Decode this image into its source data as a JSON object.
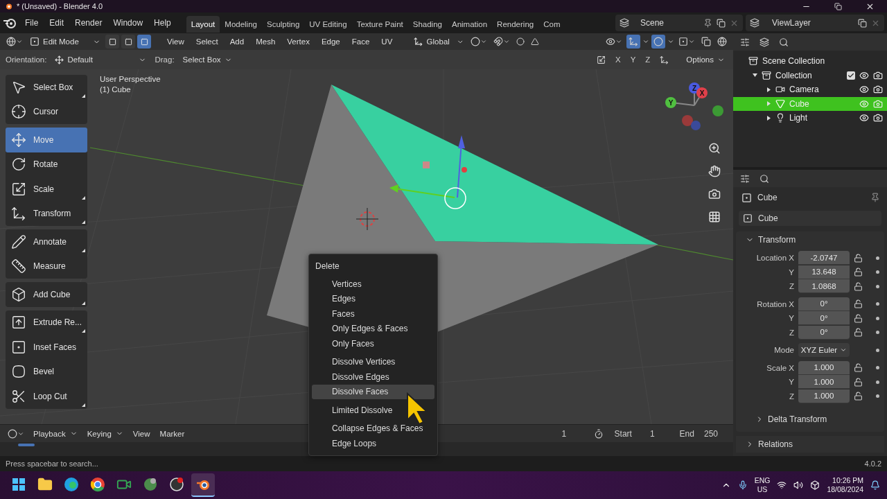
{
  "window": {
    "title": "* (Unsaved) - Blender 4.0"
  },
  "menu": [
    "File",
    "Edit",
    "Render",
    "Window",
    "Help"
  ],
  "workspaces": [
    {
      "label": "Layout",
      "selected": true
    },
    {
      "label": "Modeling",
      "selected": false
    },
    {
      "label": "Sculpting",
      "selected": false
    },
    {
      "label": "UV Editing",
      "selected": false
    },
    {
      "label": "Texture Paint",
      "selected": false
    },
    {
      "label": "Shading",
      "selected": false
    },
    {
      "label": "Animation",
      "selected": false
    },
    {
      "label": "Rendering",
      "selected": false
    },
    {
      "label": "Com",
      "selected": false
    }
  ],
  "scene": {
    "value": "Scene"
  },
  "view_layer": {
    "value": "ViewLayer"
  },
  "viewport_header": {
    "mode": "Edit Mode",
    "select_modes": [
      {
        "selected": false
      },
      {
        "selected": false
      },
      {
        "selected": true
      }
    ],
    "menus": [
      "View",
      "Select",
      "Add",
      "Mesh",
      "Vertex",
      "Edge",
      "Face",
      "UV"
    ],
    "orientation": "Global"
  },
  "tool_settings": {
    "orientation_label": "Orientation:",
    "orientation": "Default",
    "drag_label": "Drag:",
    "drag": "Select Box",
    "axes": [
      "X",
      "Y",
      "Z"
    ],
    "options": "Options"
  },
  "viewport": {
    "view_name": "User Perspective",
    "object_name": "(1) Cube",
    "gizmo_axes": [
      "Z",
      "X",
      "Y"
    ]
  },
  "tools": [
    [
      {
        "label": "Select Box",
        "selected": false,
        "submenu": true
      },
      {
        "label": "Cursor",
        "selected": false,
        "submenu": false
      }
    ],
    [
      {
        "label": "Move",
        "selected": true,
        "submenu": false
      },
      {
        "label": "Rotate",
        "selected": false,
        "submenu": false
      },
      {
        "label": "Scale",
        "selected": false,
        "submenu": true
      },
      {
        "label": "Transform",
        "selected": false,
        "submenu": true
      }
    ],
    [
      {
        "label": "Annotate",
        "selected": false,
        "submenu": true
      },
      {
        "label": "Measure",
        "selected": false,
        "submenu": false
      }
    ],
    [
      {
        "label": "Add Cube",
        "selected": false,
        "submenu": true
      }
    ],
    [
      {
        "label": "Extrude Re...",
        "selected": false,
        "submenu": true
      },
      {
        "label": "Inset Faces",
        "selected": false,
        "submenu": false
      },
      {
        "label": "Bevel",
        "selected": false,
        "submenu": false
      },
      {
        "label": "Loop Cut",
        "selected": false,
        "submenu": true
      }
    ]
  ],
  "delete_menu": {
    "title": "Delete",
    "groups": [
      [
        {
          "label": "Vertices",
          "selected": false
        },
        {
          "label": "Edges",
          "selected": false
        },
        {
          "label": "Faces",
          "selected": false
        },
        {
          "label": "Only Edges & Faces",
          "selected": false
        },
        {
          "label": "Only Faces",
          "selected": false
        }
      ],
      [
        {
          "label": "Dissolve Vertices",
          "selected": false
        },
        {
          "label": "Dissolve Edges",
          "selected": false
        },
        {
          "label": "Dissolve Faces",
          "selected": true
        }
      ],
      [
        {
          "label": "Limited Dissolve",
          "selected": false
        }
      ],
      [
        {
          "label": "Collapse Edges & Faces",
          "selected": false
        },
        {
          "label": "Edge Loops",
          "selected": false
        }
      ]
    ]
  },
  "outliner": {
    "scene_collection": "Scene Collection",
    "collection": {
      "label": "Collection",
      "expanded": true,
      "checked": true,
      "children": [
        {
          "label": "Camera",
          "kind": "camera",
          "selected": false
        },
        {
          "label": "Cube",
          "kind": "mesh",
          "selected": true
        },
        {
          "label": "Light",
          "kind": "light",
          "selected": false
        }
      ]
    }
  },
  "properties": {
    "object": "Cube",
    "data_name": "Cube",
    "transform": {
      "title": "Transform",
      "expanded": true,
      "groups": [
        {
          "kind": "fields",
          "rows": [
            {
              "label": "Location X",
              "value": "-2.0747"
            },
            {
              "label": "Y",
              "value": "13.648"
            },
            {
              "label": "Z",
              "value": "1.0868"
            }
          ]
        },
        {
          "kind": "fields",
          "rows": [
            {
              "label": "Rotation X",
              "value": "0°"
            },
            {
              "label": "Y",
              "value": "0°"
            },
            {
              "label": "Z",
              "value": "0°"
            }
          ]
        },
        {
          "kind": "dropdown",
          "rows": [
            {
              "label": "Mode",
              "value": "XYZ Euler"
            }
          ]
        },
        {
          "kind": "fields",
          "rows": [
            {
              "label": "Scale X",
              "value": "1.000"
            },
            {
              "label": "Y",
              "value": "1.000"
            },
            {
              "label": "Z",
              "value": "1.000"
            }
          ]
        }
      ],
      "subpanels": [
        {
          "title": "Delta Transform",
          "expanded": false
        }
      ]
    },
    "panels": [
      {
        "title": "Relations",
        "expanded": false
      }
    ]
  },
  "timeline": {
    "menus": [
      {
        "label": "Playback",
        "dropdown": true
      },
      {
        "label": "Keying",
        "dropdown": true
      },
      {
        "label": "View",
        "dropdown": false
      },
      {
        "label": "Marker",
        "dropdown": false
      }
    ],
    "current_frame": "1",
    "start_label": "Start",
    "start": "1",
    "end_label": "End",
    "end": "250"
  },
  "status": {
    "hint": "Press spacebar to search...",
    "version": "4.0.2"
  },
  "taskbar": {
    "apps": [
      {
        "kind": "start",
        "active": false
      },
      {
        "kind": "files",
        "active": false
      },
      {
        "kind": "edge",
        "active": false
      },
      {
        "kind": "chrome",
        "active": false
      },
      {
        "kind": "meet",
        "active": false
      },
      {
        "kind": "app",
        "active": false
      },
      {
        "kind": "obs",
        "active": false
      },
      {
        "kind": "blender",
        "active": true
      }
    ],
    "language": "ENG",
    "region": "US",
    "time": "10:26 PM",
    "date": "18/08/2024"
  }
}
